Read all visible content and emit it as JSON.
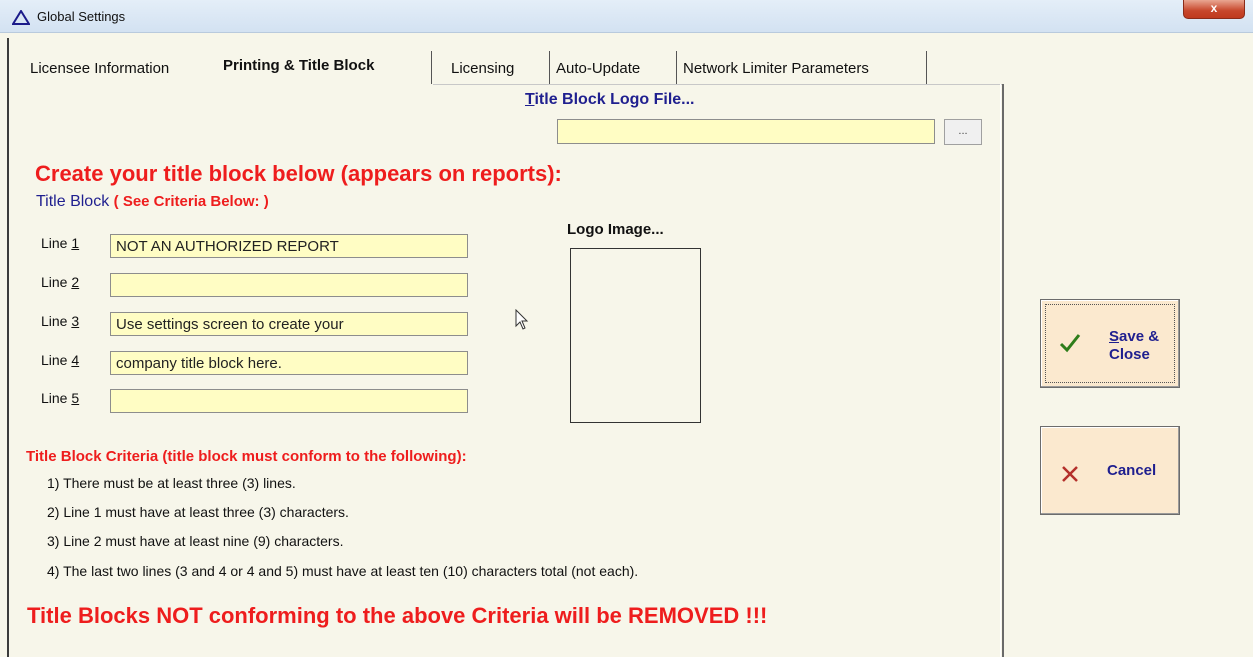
{
  "window": {
    "title": "Global Settings",
    "close_label": "x"
  },
  "tabs": [
    {
      "label": "Licensee Information",
      "active": false
    },
    {
      "label": "Printing & Title Block",
      "active": true
    },
    {
      "label": "Licensing",
      "active": false
    },
    {
      "label": "Auto-Update",
      "active": false
    },
    {
      "label": "Network Limiter Parameters",
      "active": false
    }
  ],
  "logo_file": {
    "label": "Title Block Logo File...",
    "value": "",
    "browse_label": "..."
  },
  "heading": "Create your title block below (appears on reports):",
  "title_block": {
    "label": "Title Block",
    "criteria_link": "( See Criteria Below: )"
  },
  "lines": [
    {
      "label_prefix": "Line ",
      "label_num": "1",
      "value": "NOT AN AUTHORIZED REPORT"
    },
    {
      "label_prefix": "Line ",
      "label_num": "2",
      "value": ""
    },
    {
      "label_prefix": "Line ",
      "label_num": "3",
      "value": "Use settings screen to create your"
    },
    {
      "label_prefix": "Line ",
      "label_num": "4",
      "value": "company title block here."
    },
    {
      "label_prefix": "Line ",
      "label_num": "5",
      "value": ""
    }
  ],
  "logo_image": {
    "label": "Logo Image..."
  },
  "criteria": {
    "title": "Title Block Criteria (title block must conform to the following):",
    "items": [
      "1) There must be at least three (3) lines.",
      "2) Line 1 must have at least three (3) characters.",
      "3) Line 2 must have at least nine (9) characters.",
      "4) The last two lines (3 and 4 or 4 and 5) must have at least ten (10) characters total (not each)."
    ]
  },
  "warning": "Title Blocks NOT conforming to the above Criteria will be REMOVED !!!",
  "buttons": {
    "save": {
      "line1_first": "S",
      "line1_rest": "ave &",
      "line2": "Close",
      "icon": "checkmark-icon",
      "icon_color": "#2e7d1a"
    },
    "cancel": {
      "label": "Cancel",
      "icon": "x-icon",
      "icon_color": "#b4302b"
    }
  }
}
